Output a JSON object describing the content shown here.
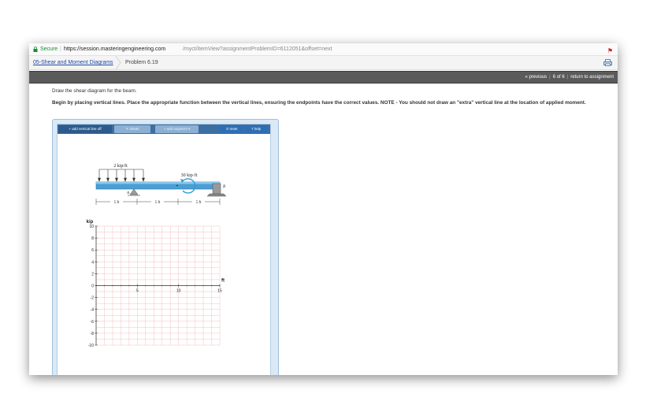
{
  "browser": {
    "secure_label": "Secure",
    "url_host": "https://session.masteringengineering.com",
    "url_path": "/myct/itemView?assignmentProblemID=6112051&offset=next"
  },
  "breadcrumb": {
    "link": "05-Shear and Moment Diagrams",
    "current": "Problem 6.19"
  },
  "nav": {
    "previous": "« previous",
    "position": "6 of 6",
    "return": "return to assignment"
  },
  "instructions": {
    "line1": "Draw the shear diagram for the beam.",
    "line2": "Begin by placing vertical lines. Place the appropriate function between the vertical lines, ensuring the endpoints have the correct values. NOTE - You should not draw an \"extra\" vertical line at the location of applied moment."
  },
  "toolbar": {
    "add_vertical_line": "add vertical line off",
    "delete": "delete",
    "add_segment": "add segment",
    "reset": "reset",
    "help": "help"
  },
  "beam": {
    "load_label": "2 kip/ft",
    "moment_label": "30 kip·ft",
    "support_a": "A",
    "support_b": "B",
    "spans": [
      "5 ft",
      "5 ft",
      "5 ft"
    ]
  },
  "chart_data": {
    "type": "line",
    "ylabel": "kip",
    "xlabel": "ft",
    "x_ticks": [
      5,
      10,
      15
    ],
    "y_ticks": [
      10,
      8,
      6,
      4,
      2,
      0,
      -2,
      -4,
      -6,
      -8,
      -10
    ],
    "xlim": [
      0,
      15
    ],
    "ylim": [
      -10,
      10
    ],
    "grid": true,
    "series": []
  },
  "colors": {
    "nav_bg": "#5a5a5a",
    "panel_bg": "#dbe9f6",
    "toolbar_bg": "#3d6fa3",
    "grid": "#f4c0c0",
    "beam": "#4a9fd4",
    "moment_arrow": "#2a9fd6"
  }
}
